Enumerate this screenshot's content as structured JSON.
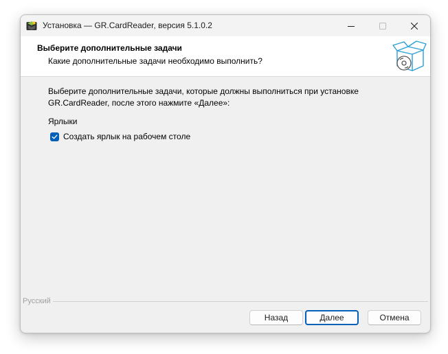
{
  "window": {
    "title": "Установка — GR.CardReader, версия 5.1.0.2",
    "icons": {
      "app": "installer-app-icon",
      "minimize": "minimize-icon",
      "maximize": "maximize-icon",
      "close": "close-icon",
      "header_image": "software-box-cd-icon",
      "check": "checkmark-icon"
    }
  },
  "header": {
    "title": "Выберите дополнительные задачи",
    "subtitle": "Какие дополнительные задачи необходимо выполнить?"
  },
  "body": {
    "instruction_line1": "Выберите дополнительные задачи, которые должны выполниться при установке",
    "instruction_line2": "GR.CardReader, после этого нажмите «Далее»:",
    "group_label": "Ярлыки",
    "tasks": [
      {
        "label": "Создать ярлык на рабочем столе",
        "checked": true
      }
    ]
  },
  "footer": {
    "language": "Русский",
    "back_label": "Назад",
    "next_label": "Далее",
    "cancel_label": "Отмена"
  },
  "colors": {
    "accent": "#005fb8",
    "dialog_background": "#f0f0f0",
    "header_background": "#ffffff"
  }
}
